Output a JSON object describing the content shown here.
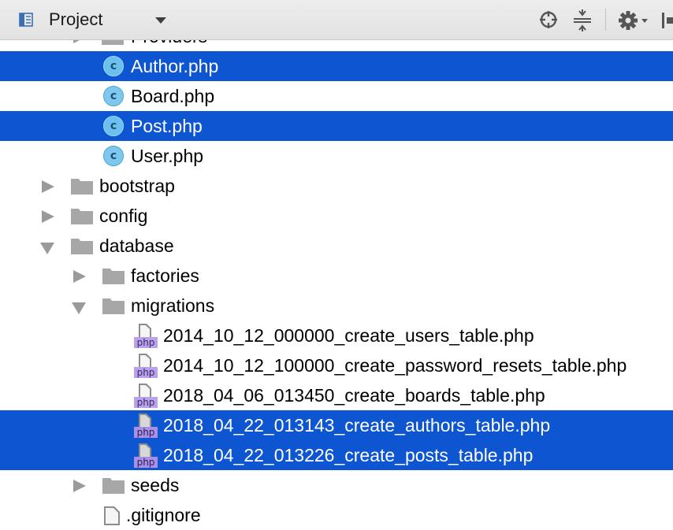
{
  "panel": {
    "title": "Project",
    "icons": {
      "project": "project-view-icon",
      "dropdown": "chevron-down-icon",
      "locate": "locate-target-icon",
      "collapse": "collapse-all-icon",
      "settings": "gear-icon",
      "hide": "hide-panel-icon"
    }
  },
  "colors": {
    "selection": "#0d55d1",
    "class_icon": "#7ec8ee",
    "folder": "#a7a7a7",
    "php_tag": "#b9a2ea"
  },
  "tree": {
    "rows": [
      {
        "label": "Providers",
        "type": "folder",
        "expanded": false,
        "selected": false
      },
      {
        "label": "Author.php",
        "type": "class",
        "selected": true
      },
      {
        "label": "Board.php",
        "type": "class",
        "selected": false
      },
      {
        "label": "Post.php",
        "type": "class",
        "selected": true
      },
      {
        "label": "User.php",
        "type": "class",
        "selected": false
      },
      {
        "label": "bootstrap",
        "type": "folder",
        "expanded": false,
        "selected": false
      },
      {
        "label": "config",
        "type": "folder",
        "expanded": false,
        "selected": false
      },
      {
        "label": "database",
        "type": "folder",
        "expanded": true,
        "selected": false
      },
      {
        "label": "factories",
        "type": "folder",
        "expanded": false,
        "selected": false
      },
      {
        "label": "migrations",
        "type": "folder",
        "expanded": true,
        "selected": false
      },
      {
        "label": "2014_10_12_000000_create_users_table.php",
        "type": "php",
        "tag": "php",
        "selected": false
      },
      {
        "label": "2014_10_12_100000_create_password_resets_table.php",
        "type": "php",
        "tag": "php",
        "selected": false
      },
      {
        "label": "2018_04_06_013450_create_boards_table.php",
        "type": "php",
        "tag": "php",
        "selected": false
      },
      {
        "label": "2018_04_22_013143_create_authors_table.php",
        "type": "php",
        "tag": "php",
        "selected": true
      },
      {
        "label": "2018_04_22_013226_create_posts_table.php",
        "type": "php",
        "tag": "php",
        "selected": true
      },
      {
        "label": "seeds",
        "type": "folder",
        "expanded": false,
        "selected": false
      },
      {
        "label": ".gitignore",
        "type": "file",
        "selected": false
      }
    ]
  }
}
